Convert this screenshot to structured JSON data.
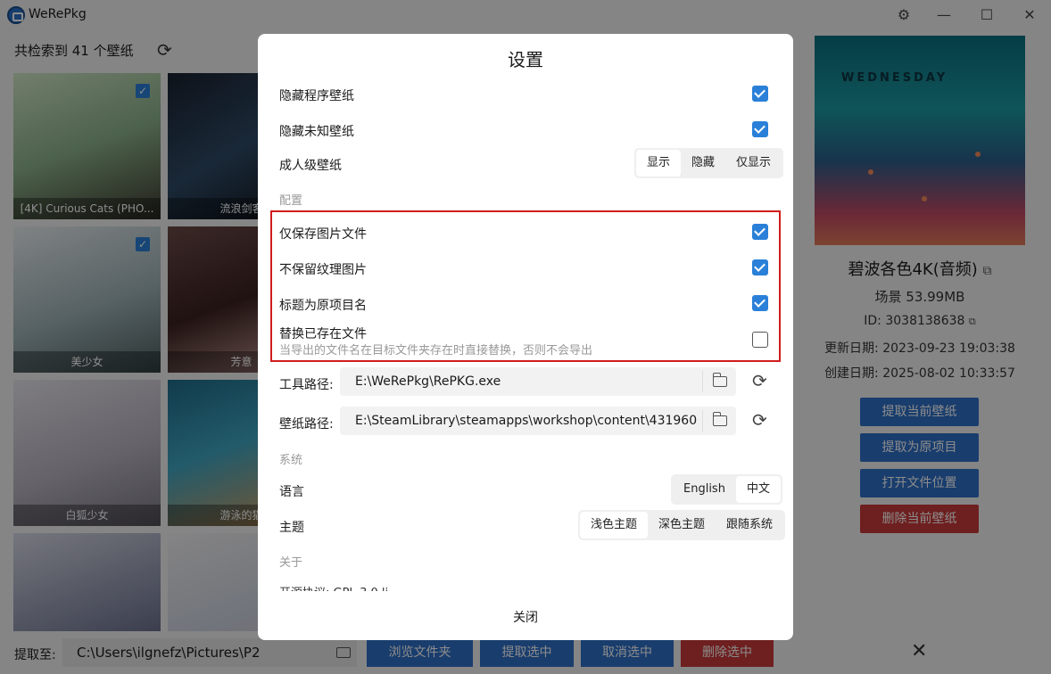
{
  "app": {
    "title": "WeRePkg"
  },
  "main": {
    "count_text": "共检索到 41 个壁纸"
  },
  "cards": [
    {
      "caption": "[4K] Curious Cats (PHO...",
      "checked": true
    },
    {
      "caption": "流浪剑客",
      "checked": false
    },
    {
      "caption": "美少女",
      "checked": true
    },
    {
      "caption": "芳意",
      "checked": false
    },
    {
      "caption": "白狐少女",
      "checked": false
    },
    {
      "caption": "游泳的猫",
      "checked": false
    }
  ],
  "preview": {
    "art_text": "WEDNESDAY",
    "title": "碧波各色4K(音频)",
    "type_size": "场景   53.99MB",
    "id": "ID: 3038138638",
    "updated": "更新日期: 2023-09-23 19:03:38",
    "created": "创建日期: 2025-08-02 10:33:57"
  },
  "side_buttons": {
    "extract_current": "提取当前壁纸",
    "extract_original": "提取为原项目",
    "open_location": "打开文件位置",
    "delete_current": "删除当前壁纸"
  },
  "bottom": {
    "extract_label": "提取至:",
    "extract_path": "C:\\Users\\ilgnefz\\Pictures\\P2",
    "browse": "浏览文件夹",
    "extract_selected": "提取选中",
    "cancel_selected": "取消选中",
    "delete_selected": "删除选中"
  },
  "settings": {
    "title": "设置",
    "hide_program": {
      "label": "隐藏程序壁纸",
      "checked": true
    },
    "hide_unknown": {
      "label": "隐藏未知壁纸",
      "checked": true
    },
    "adult": {
      "label": "成人级壁纸",
      "options": [
        "显示",
        "隐藏",
        "仅显示"
      ],
      "selected": "显示"
    },
    "section_config": "配置",
    "only_images": {
      "label": "仅保存图片文件",
      "checked": true
    },
    "no_texture": {
      "label": "不保留纹理图片",
      "checked": true
    },
    "title_as_name": {
      "label": "标题为原项目名",
      "checked": true
    },
    "replace_existing": {
      "label": "替换已存在文件",
      "hint": "当导出的文件名在目标文件夹存在时直接替换，否则不会导出",
      "checked": false
    },
    "tool_path": {
      "label": "工具路径:",
      "value": "E:\\WeRePkg\\RePKG.exe"
    },
    "wallpaper_path": {
      "label": "壁纸路径:",
      "value": "E:\\SteamLibrary\\steamapps\\workshop\\content\\431960"
    },
    "section_system": "系统",
    "language": {
      "label": "语言",
      "options": [
        "English",
        "中文"
      ],
      "selected": "中文"
    },
    "theme": {
      "label": "主题",
      "options": [
        "浅色主题",
        "深色主题",
        "跟随系统"
      ],
      "selected": "浅色主题"
    },
    "section_about": "关于",
    "license_partial": "开源协议: GPL-3.0 li",
    "close": "关闭"
  }
}
